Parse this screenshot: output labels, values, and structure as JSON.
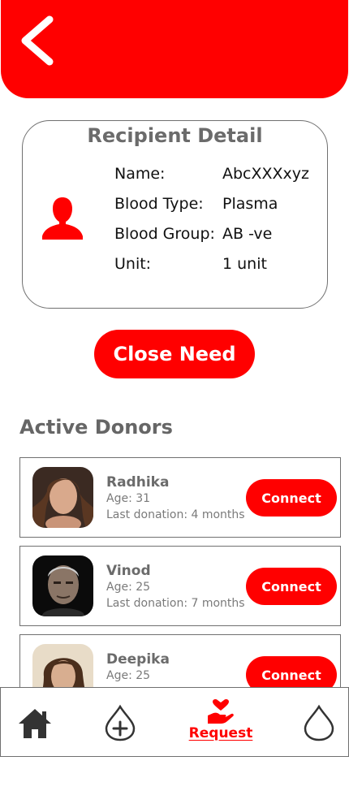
{
  "header": {
    "back_icon": "chevron-left-icon",
    "background": "#ff0000"
  },
  "recipient": {
    "title": "Recipient Detail",
    "icon": "person-icon",
    "rows": [
      {
        "label": "Name:",
        "value": "AbcXXXxyz"
      },
      {
        "label": "Blood Type:",
        "value": "Plasma"
      },
      {
        "label": "Blood Group:",
        "value": "AB -ve"
      },
      {
        "label": "Unit:",
        "value": "1 unit"
      }
    ]
  },
  "close_button": "Close Need",
  "active_donors": {
    "title": "Active Donors",
    "donors": [
      {
        "name": "Radhika",
        "age": "Age: 31",
        "last": "Last donation: 4 months",
        "button": "Connect"
      },
      {
        "name": "Vinod",
        "age": "Age: 25",
        "last": "Last donation: 7 months",
        "button": "Connect"
      },
      {
        "name": "Deepika",
        "age": "Age: 25",
        "last": "",
        "button": "Connect"
      }
    ]
  },
  "nav": {
    "items": [
      {
        "icon": "home-icon",
        "label": ""
      },
      {
        "icon": "add-blood-drop-icon",
        "label": ""
      },
      {
        "icon": "heart-hand-icon",
        "label": "Request",
        "active": true
      },
      {
        "icon": "blood-drop-icon",
        "label": ""
      }
    ]
  },
  "colors": {
    "accent": "#ff0000",
    "text_gray": "#6b6b6b",
    "border": "#707070"
  }
}
